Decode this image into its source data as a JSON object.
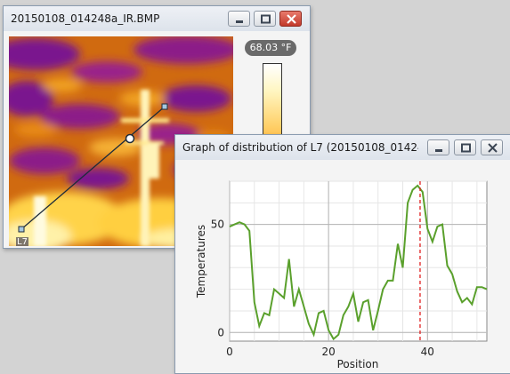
{
  "image_window": {
    "title": "20150108_014248a_IR.BMP",
    "line_label": "L7",
    "current_temp": "68.03 °F",
    "buttons": {
      "minimize": "minimize-icon",
      "maximize": "maximize-icon",
      "close": "close-icon"
    }
  },
  "graph_window": {
    "title": "Graph of distribution of L7 (20150108_01424...",
    "buttons": {
      "minimize": "minimize-icon",
      "maximize": "maximize-icon",
      "close": "close-icon"
    }
  },
  "chart_data": {
    "type": "line",
    "xlabel": "Position",
    "ylabel": "Temperatures",
    "xlim": [
      0,
      52
    ],
    "ylim": [
      -4,
      70
    ],
    "x_ticks": [
      "0",
      "20",
      "40"
    ],
    "y_ticks": [
      "0",
      "50"
    ],
    "grid": true,
    "series_color": "#5aa02c",
    "marker_color": "#e02020",
    "marker_x": 38.5,
    "series": [
      {
        "x": [
          0,
          1,
          2,
          3,
          4,
          5,
          6,
          7,
          8,
          9,
          10,
          11,
          12,
          13,
          14,
          15,
          16,
          17,
          18,
          19,
          20,
          21,
          22,
          23,
          24,
          25,
          26,
          27,
          28,
          29,
          30,
          31,
          32,
          33,
          34,
          35,
          36,
          37,
          38,
          39,
          40,
          41,
          42,
          43,
          44,
          45,
          46,
          47,
          48,
          49,
          50,
          51,
          52
        ],
        "values": [
          49,
          50,
          51,
          50,
          47,
          14,
          3,
          9,
          8,
          20,
          18,
          16,
          34,
          12,
          20,
          12,
          4,
          -1,
          9,
          10,
          1,
          -3,
          -1,
          8,
          12,
          18,
          5,
          14,
          15,
          1,
          10,
          20,
          24,
          24,
          41,
          30,
          60,
          66,
          68,
          65,
          48,
          42,
          49,
          50,
          31,
          27,
          19,
          14,
          16,
          13,
          21,
          21,
          20
        ]
      }
    ]
  }
}
